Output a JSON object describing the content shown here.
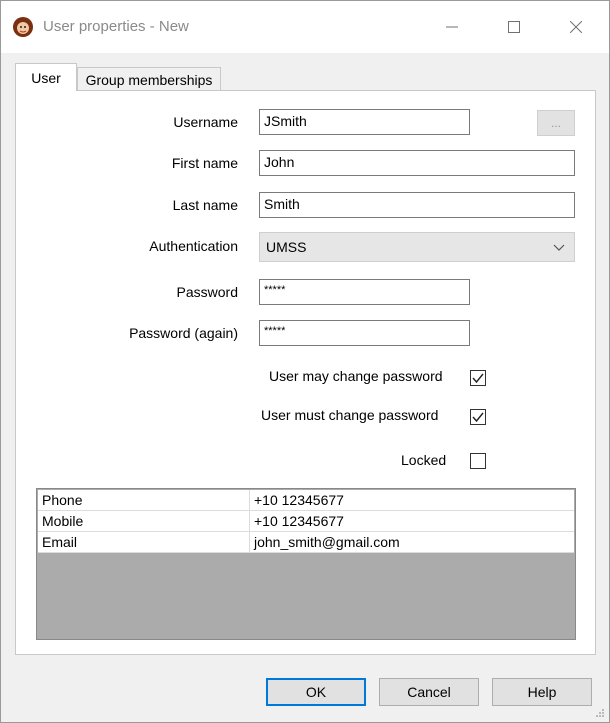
{
  "window": {
    "title": "User properties - New",
    "controls": {
      "minimize": "minimize-icon",
      "maximize": "maximize-icon",
      "close": "close-icon"
    }
  },
  "tabs": [
    {
      "label": "User",
      "active": true
    },
    {
      "label": "Group memberships",
      "active": false
    }
  ],
  "form": {
    "username": {
      "label": "Username",
      "value": "JSmith",
      "browse_label": "..."
    },
    "first_name": {
      "label": "First name",
      "value": "John"
    },
    "last_name": {
      "label": "Last name",
      "value": "Smith"
    },
    "authentication": {
      "label": "Authentication",
      "value": "UMSS"
    },
    "password": {
      "label": "Password",
      "value": "*****"
    },
    "password_again": {
      "label": "Password (again)",
      "value": "*****"
    },
    "may_change": {
      "label": "User may change password",
      "checked": true
    },
    "must_change": {
      "label": "User must change password",
      "checked": true
    },
    "locked": {
      "label": "Locked",
      "checked": false
    }
  },
  "contacts": [
    {
      "key": "Phone",
      "value": "+10 12345677"
    },
    {
      "key": "Mobile",
      "value": "+10 12345677"
    },
    {
      "key": "Email",
      "value": "john_smith@gmail.com"
    }
  ],
  "buttons": {
    "ok": "OK",
    "cancel": "Cancel",
    "help": "Help"
  },
  "colors": {
    "accent": "#0078d7",
    "window_bg": "#f0f0f0",
    "grid_empty": "#ababab"
  }
}
